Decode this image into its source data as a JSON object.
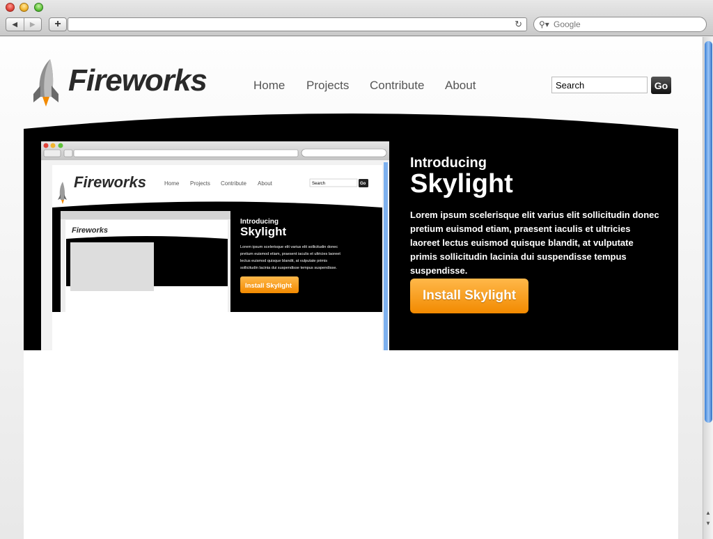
{
  "browser": {
    "search_placeholder": "Google"
  },
  "site": {
    "brand": "Fireworks",
    "nav": [
      "Home",
      "Projects",
      "Contribute",
      "About"
    ],
    "search": {
      "value": "Search",
      "go_label": "Go"
    }
  },
  "hero": {
    "eyebrow": "Introducing",
    "title": "Skylight",
    "description": "Lorem ipsum scelerisque elit varius elit sollicitudin donec pretium euismod etiam, praesent iaculis et ultricies laoreet lectus euismod quisque blandit, at vulputate primis sollicitudin lacinia dui suspendisse tempus suspendisse.",
    "install_label": "Install Skylight"
  },
  "colors": {
    "accent_orange": "#f28a00",
    "hero_bg": "#000000",
    "scrollbar_blue": "#3a7fd6"
  }
}
